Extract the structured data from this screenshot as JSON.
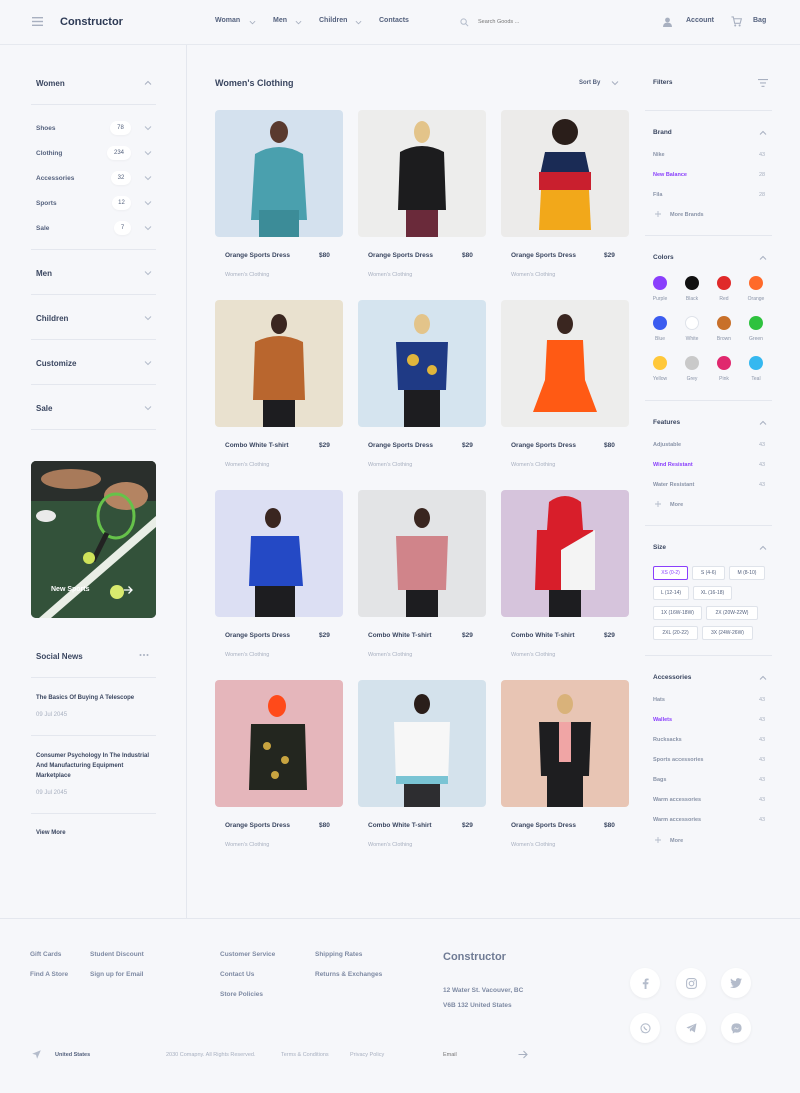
{
  "header": {
    "brand": "Constructor",
    "nav": [
      "Woman",
      "Men",
      "Children",
      "Contacts"
    ],
    "search_placeholder": "Search Goods ...",
    "account": "Account",
    "bag": "Bag"
  },
  "sidebar": {
    "women": "Women",
    "sub_items": [
      {
        "label": "Shoes",
        "count": "78"
      },
      {
        "label": "Clothing",
        "count": "234"
      },
      {
        "label": "Accessories",
        "count": "32"
      },
      {
        "label": "Sports",
        "count": "12"
      },
      {
        "label": "Sale",
        "count": "7"
      }
    ],
    "categories": [
      "Men",
      "Children",
      "Customize",
      "Sale"
    ],
    "promo_label": "New Sports",
    "social_news_title": "Social News",
    "news": [
      {
        "title": "The Basics Of Buying A Telescope",
        "date": "09 Jul 2045"
      },
      {
        "title_lines": [
          "Consumer Psychology In The Industrial",
          "And Manufacturing Equipment",
          "Marketplace"
        ],
        "date": "09 Jul 2045"
      }
    ],
    "view_more": "View More"
  },
  "main": {
    "title": "Women's Clothing",
    "sort_by": "Sort By",
    "products": [
      {
        "name": "Orange Sports Dress",
        "price": "$80",
        "category": "Women's Clothing"
      },
      {
        "name": "Orange Sports Dress",
        "price": "$80",
        "category": "Women's Clothing"
      },
      {
        "name": "Orange Sports Dress",
        "price": "$29",
        "category": "Women's Clothing"
      },
      {
        "name": "Combo White T-shirt",
        "price": "$29",
        "category": "Women's Clothing"
      },
      {
        "name": "Orange Sports Dress",
        "price": "$29",
        "category": "Women's Clothing"
      },
      {
        "name": "Orange Sports Dress",
        "price": "$80",
        "category": "Women's Clothing"
      },
      {
        "name": "Orange Sports Dress",
        "price": "$29",
        "category": "Women's Clothing"
      },
      {
        "name": "Combo White T-shirt",
        "price": "$29",
        "category": "Women's Clothing"
      },
      {
        "name": "Combo White T-shirt",
        "price": "$29",
        "category": "Women's Clothing"
      },
      {
        "name": "Orange Sports Dress",
        "price": "$80",
        "category": "Women's Clothing"
      },
      {
        "name": "Combo White T-shirt",
        "price": "$29",
        "category": "Women's Clothing"
      },
      {
        "name": "Orange Sports Dress",
        "price": "$80",
        "category": "Women's Clothing"
      }
    ]
  },
  "filters": {
    "title": "Filters",
    "brand": {
      "title": "Brand",
      "items": [
        {
          "label": "Nike",
          "count": "43"
        },
        {
          "label": "New Balance",
          "count": "28"
        },
        {
          "label": "Fila",
          "count": "28"
        }
      ],
      "more": "More Brands"
    },
    "colors": {
      "title": "Colors",
      "items": [
        {
          "label": "Purple",
          "hex": "#8a3ffc"
        },
        {
          "label": "Black",
          "hex": "#111111"
        },
        {
          "label": "Red",
          "hex": "#e02a2a"
        },
        {
          "label": "Orange",
          "hex": "#ff6a2a"
        },
        {
          "label": "Blue",
          "hex": "#3b5cf0"
        },
        {
          "label": "White",
          "hex": "#ffffff"
        },
        {
          "label": "Brown",
          "hex": "#c8702a"
        },
        {
          "label": "Green",
          "hex": "#2ec23e"
        },
        {
          "label": "Yellow",
          "hex": "#ffc83a"
        },
        {
          "label": "Grey",
          "hex": "#c9c9c9"
        },
        {
          "label": "Pink",
          "hex": "#e0286e"
        },
        {
          "label": "Teal",
          "hex": "#35b8f0"
        }
      ]
    },
    "features": {
      "title": "Features",
      "items": [
        {
          "label": "Adjustable",
          "count": "43"
        },
        {
          "label": "Wind Resistant",
          "count": "43"
        },
        {
          "label": "Water Resistant",
          "count": "43"
        }
      ],
      "more": "More"
    },
    "size": {
      "title": "Size",
      "chips": [
        "XS (0-2)",
        "S (4-6)",
        "M (8-10)",
        "L (12-14)",
        "XL (16-18)",
        "1X (16W-18W)",
        "2X (20W-22W)",
        "2XL (20-22)",
        "3X (24W-26W)"
      ]
    },
    "accessories": {
      "title": "Accessories",
      "items": [
        {
          "label": "Hats",
          "count": "43"
        },
        {
          "label": "Wallets",
          "count": "43"
        },
        {
          "label": "Rucksacks",
          "count": "43"
        },
        {
          "label": "Sports accessories",
          "count": "43"
        },
        {
          "label": "Bags",
          "count": "43"
        },
        {
          "label": "Warm accessories",
          "count": "43"
        },
        {
          "label": "Warm accessories",
          "count": "43"
        }
      ],
      "more": "More"
    }
  },
  "footer": {
    "col1": [
      "Gift Cards",
      "Find A Store"
    ],
    "col2": [
      "Student Discount",
      "Sign up for Email"
    ],
    "col3": [
      "Customer Service",
      "Contact Us",
      "Store Policies"
    ],
    "col4": [
      "Shipping Rates",
      "Returns & Exchanges"
    ],
    "brand": "Constructor",
    "address1": "12 Water St. Vacouver, BC",
    "address2": "V6B 132 United States",
    "country": "United States",
    "copyright": "2030 Comapny. All Rights Reserved.",
    "terms": "Terms & Conditions",
    "privacy": "Privacy Policy",
    "email_placeholder": "Email",
    "socials": [
      "facebook-icon",
      "instagram-icon",
      "twitter-icon",
      "whatsapp-icon",
      "telegram-icon",
      "messenger-icon"
    ]
  }
}
